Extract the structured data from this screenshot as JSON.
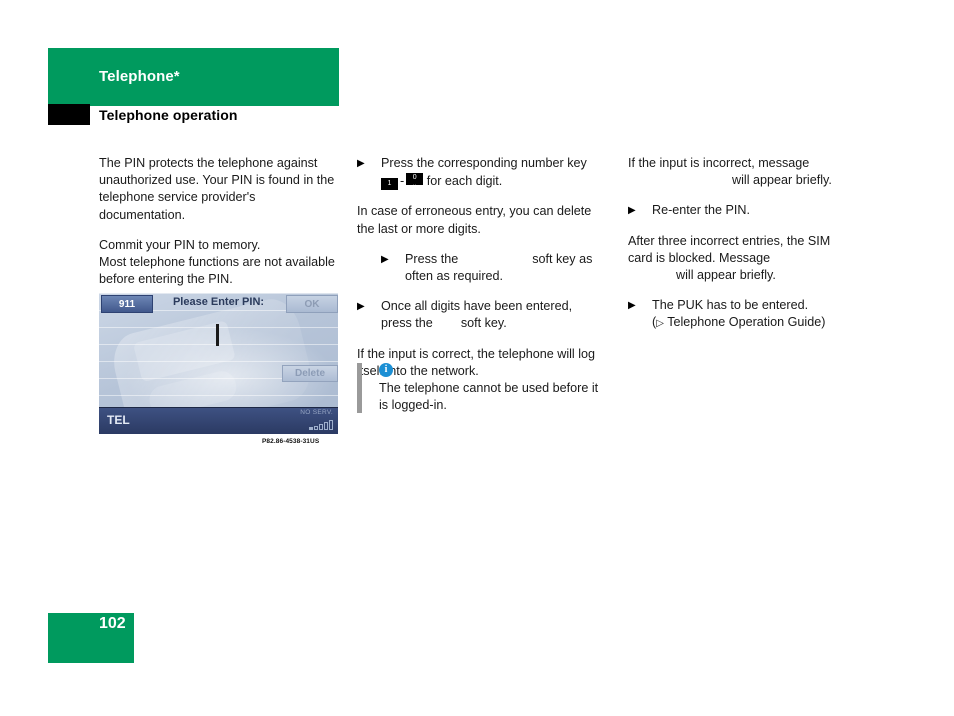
{
  "header": {
    "chapter_title": "Telephone*",
    "section_title": "Telephone operation"
  },
  "footer": {
    "page_number": "102"
  },
  "colors": {
    "brand_green": "#009a5e",
    "info_blue": "#1b8fd4",
    "note_rule_gray": "#9a9a9a",
    "display_blue": "#2b3a63"
  },
  "columns": {
    "left": {
      "paragraph_1": "The PIN protects the telephone against unauthorized use. Your PIN is found in the telephone service provider's documentation.",
      "paragraph_2_line_1": "Commit your PIN to memory.",
      "paragraph_2_line_2": "Most telephone functions are not available",
      "paragraph_2_line_3": "before entering the PIN."
    },
    "middle": {
      "step_1_text_before_keys": "Press the corresponding number key",
      "step_1_key_from": "1",
      "step_1_key_to": "0",
      "step_1_key_to_sub": "␣",
      "step_1_dash": "-",
      "step_1_text_after_keys": "for each digit.",
      "paragraph_1": "In case of erroneous entry, you can delete the last or more digits.",
      "step_2_text_before_gap": "Press the",
      "step_2_text_after_gap": "soft key as often as required.",
      "step_3_line_1": "Once all digits have been entered,",
      "step_3_line_2_before_gap": "press the",
      "step_3_line_2_after_gap": "soft key.",
      "paragraph_2": "If the input is correct, the telephone will log itself into the network."
    },
    "right": {
      "paragraph_1_line_1": "If the input is incorrect, message",
      "paragraph_1_line_2": "will appear briefly.",
      "step_1": "Re-enter the PIN.",
      "paragraph_2_line_1": "After three incorrect entries, the SIM",
      "paragraph_2_line_2": "card is blocked. Message",
      "paragraph_2_line_3": "will appear briefly.",
      "step_2_line_1": "The PUK has to be entered.",
      "step_2_line_2_prefix": "(",
      "step_2_line_2_arrow": "▷",
      "step_2_line_2_text": "Telephone Operation Guide)"
    }
  },
  "figure": {
    "caption_code": "P82.86-4538-31US",
    "display": {
      "emergency_button_label": "911",
      "prompt_label": "Please Enter PIN:",
      "ok_softkey_label": "OK",
      "delete_softkey_label": "Delete",
      "mode_label": "TEL",
      "service_status": "NO SERV."
    }
  },
  "icons": {
    "bullet_triangle": "▶",
    "info_letter": "i"
  }
}
